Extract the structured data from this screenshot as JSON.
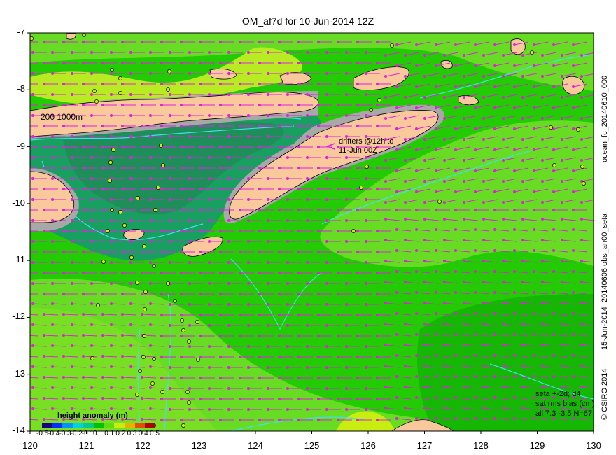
{
  "title": "OM_af7d for 10-Jun-2014 12Z",
  "axes": {
    "x_ticks": [
      "120",
      "121",
      "122",
      "123",
      "124",
      "125",
      "126",
      "127",
      "128",
      "129",
      "130"
    ],
    "y_ticks": [
      "-7",
      "-8",
      "-9",
      "-10",
      "-11",
      "-12",
      "-13",
      "-14"
    ],
    "xlim": [
      120,
      130
    ],
    "ylim": [
      -14,
      -7
    ]
  },
  "labels": {
    "isobath": "200  1000m",
    "drifters_line1": "drifters @12h to",
    "drifters_line2": "11-Jun 00Z",
    "legend_title": "height anomaly (m)",
    "stats_line1": "seta +-2d; d4",
    "stats_line2": "sat rms bias (cm)",
    "stats_line3": "all 7.3 -3.5 N=67"
  },
  "colorbar": {
    "ticks": [
      "-0.5",
      "-0.4",
      "-0.3",
      "-0.2",
      "-0.1",
      "0",
      "0.1",
      "0.2",
      "0.3",
      "0.4",
      "0.5"
    ],
    "colors": [
      "#1a0080",
      "#0030ff",
      "#0090ff",
      "#00d0e0",
      "#00c890",
      "#00c000",
      "#60dc10",
      "#c8ee10",
      "#e8b000",
      "#e05000",
      "#b00000"
    ]
  },
  "right_labels": {
    "run": "ocean_fc_20140610_000",
    "obs": "20140606 obs_an00_seta",
    "made": "15-Jun-2014",
    "copyright": "© CSIRO 2014"
  },
  "colors": {
    "land": "#f9c99b",
    "shelf": "#a8a8a8",
    "arrow": "#e020e0",
    "contour": "#40e0f0",
    "field_base": "#22cc00"
  }
}
